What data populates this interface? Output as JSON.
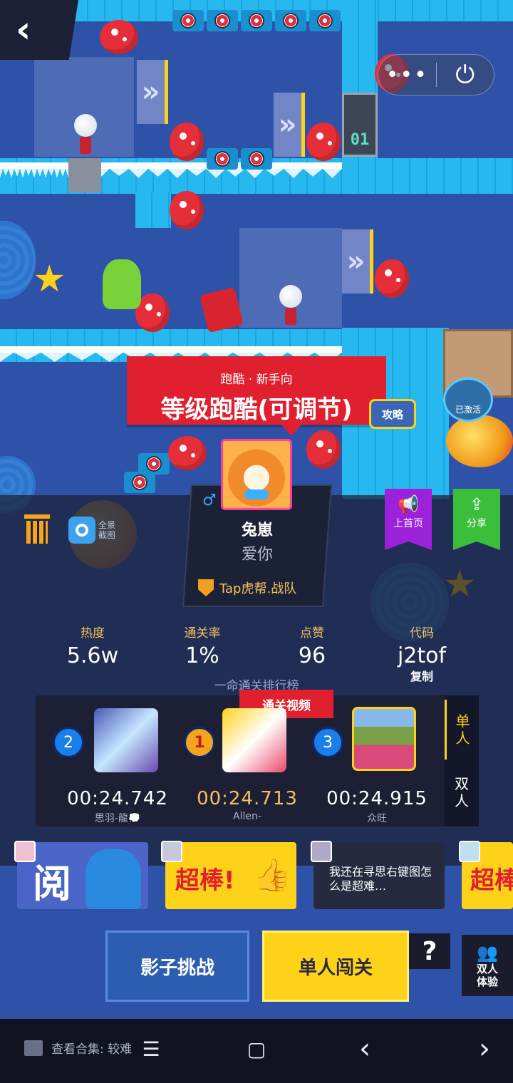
{
  "top": {
    "back_icon": "‹",
    "more_icon": "•••",
    "power_icon": "⏻"
  },
  "level": {
    "category": "跑酷 · 新手向",
    "title": "等级跑酷(可调节)",
    "guide_badge": "攻略",
    "activated_badge": "已激活",
    "sign_digits": "01"
  },
  "author": {
    "gender_icon": "♂",
    "name": "兔崽",
    "signature": "爱你",
    "team": "Tap虎帮.战队"
  },
  "tools": {
    "panorama_label": "全景截图"
  },
  "flags": [
    {
      "label": "上首页",
      "color": "#9b22d8"
    },
    {
      "label": "分享",
      "color": "#3bbf3b"
    }
  ],
  "stats": [
    {
      "label": "热度",
      "value": "5.6w"
    },
    {
      "label": "通关率",
      "value": "1%"
    },
    {
      "label": "点赞",
      "value": "96"
    },
    {
      "label": "代码",
      "value": "j2tof"
    }
  ],
  "copy_label": "复制",
  "ranking": {
    "title": "一命通关排行榜",
    "video_tag": "通关视频",
    "entries": [
      {
        "rank": "2",
        "time": "00:24.742",
        "name": "思羽-龍💭"
      },
      {
        "rank": "1",
        "time": "00:24.713",
        "name": "Allen-"
      },
      {
        "rank": "3",
        "time": "00:24.915",
        "name": "众旺"
      }
    ],
    "tabs": [
      {
        "label": "单人",
        "active": true
      },
      {
        "label": "双人",
        "active": false
      }
    ]
  },
  "comments": [
    {
      "text": "阅"
    },
    {
      "text": "超棒!"
    },
    {
      "text": "我还在寻思右键图怎么是超难…"
    },
    {
      "text": "超棒"
    }
  ],
  "buttons": {
    "shadow_challenge": "影子挑战",
    "solo_play": "单人闯关",
    "help": "?",
    "duo_trial": "双人体验"
  },
  "bottom": {
    "collection": "查看合集: 较难",
    "menu_icon": "☰",
    "home_icon": "▢",
    "back_icon": "‹",
    "next_icon": "›"
  },
  "colors": {
    "banner_red": "#e0202e",
    "accent_yellow": "#ffd21a",
    "rank_gold": "#f5c060"
  }
}
